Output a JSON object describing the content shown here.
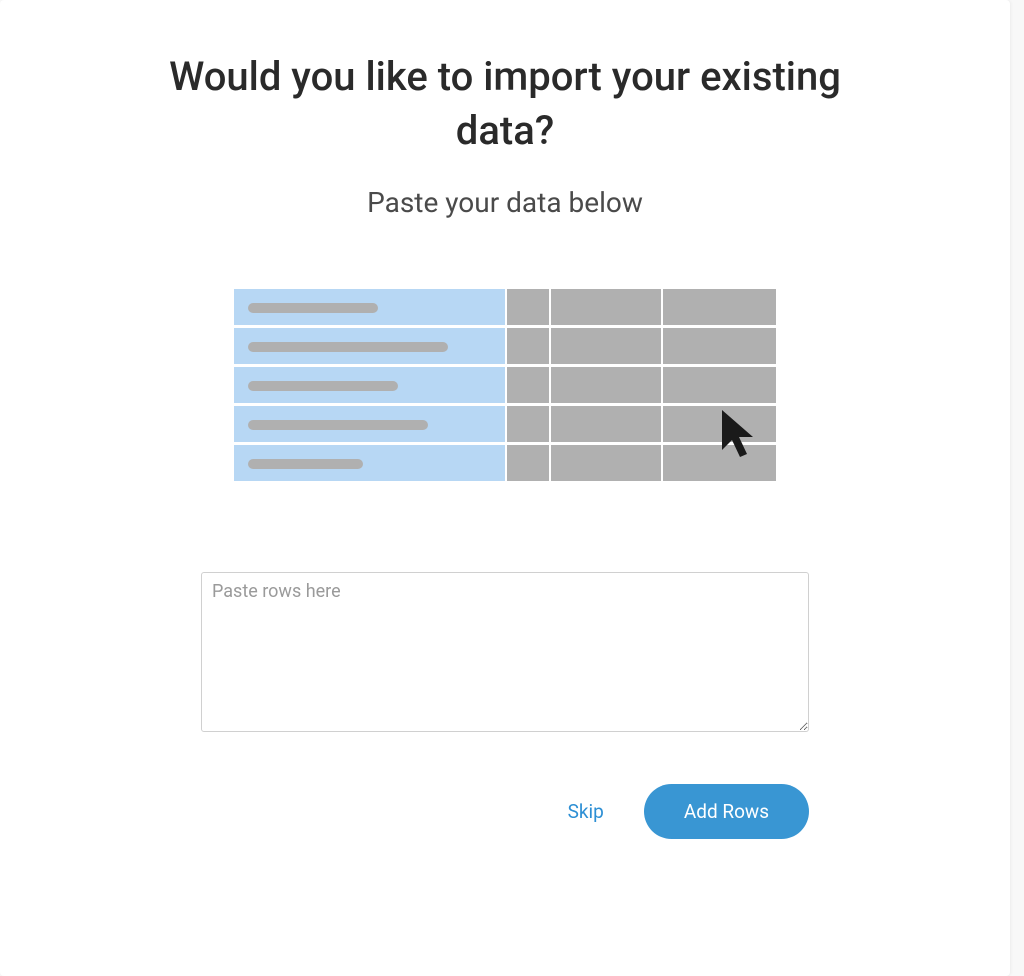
{
  "dialog": {
    "heading": "Would you like to import your existing data?",
    "subheading": "Paste your data below",
    "textarea": {
      "placeholder": "Paste rows here",
      "value": ""
    },
    "actions": {
      "skip_label": "Skip",
      "primary_label": "Add Rows"
    },
    "colors": {
      "accent": "#3996d3",
      "illustration_blue": "#b7d7f4",
      "illustration_gray": "#b0b0b0",
      "illustration_gray_light": "#b6b6b6"
    }
  }
}
